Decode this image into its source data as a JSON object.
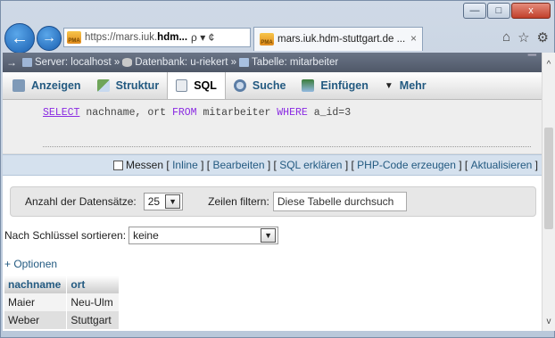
{
  "window": {
    "minimize_glyph": "—",
    "maximize_glyph": "□",
    "close_glyph": "x"
  },
  "browser": {
    "back_glyph": "←",
    "forward_glyph": "→",
    "address": {
      "logo_text": "PMA",
      "url_prefix": "https://mars.iuk.",
      "url_host": "hdm...",
      "tools": "ρ ▾ ¢"
    },
    "tab": {
      "logo_text": "PMA",
      "title": "mars.iuk.hdm-stuttgart.de ...",
      "close_glyph": "×"
    },
    "home_glyph": "⌂",
    "star_glyph": "☆",
    "gear_glyph": "⚙"
  },
  "breadcrumb": {
    "arrow": "→",
    "server": "Server: localhost »",
    "database": "Datenbank: u-riekert »",
    "table": "Tabelle: mitarbeiter",
    "caret": "▔"
  },
  "menu": {
    "browse": "Anzeigen",
    "structure": "Struktur",
    "sql": "SQL",
    "search": "Suche",
    "insert": "Einfügen",
    "more_caret": "▼",
    "more": "Mehr"
  },
  "sql": {
    "select_kw": "SELECT",
    "columns": " nachname, ort ",
    "from_kw": "FROM",
    "table": " mitarbeiter ",
    "where_kw": "WHERE",
    "condition": " a_id=3"
  },
  "sql_actions": {
    "profiling": "Messen",
    "open_bracket_1": "[",
    "inline": "Inline",
    "sep_1": "] [",
    "edit": "Bearbeiten",
    "sep_2": "] [",
    "explain": "SQL erklären",
    "sep_3": "] [",
    "php": "PHP-Code erzeugen",
    "sep_4": "] [",
    "refresh": "Aktualisieren",
    "close_bracket": "]"
  },
  "navigation": {
    "rows_label": "Anzahl der Datensätze:",
    "rows_value": "25",
    "filter_label": "Zeilen filtern:",
    "filter_placeholder": "Diese Tabelle durchsuch"
  },
  "sort": {
    "label": "Nach Schlüssel sortieren:",
    "value": "keine"
  },
  "options_link": "+ Optionen",
  "table": {
    "headers": [
      "nachname",
      "ort"
    ],
    "rows": [
      [
        "Maier",
        "Neu-Ulm"
      ],
      [
        "Weber",
        "Stuttgart"
      ]
    ]
  },
  "scrollbar": {
    "up_glyph": "^",
    "down_glyph": "v"
  }
}
